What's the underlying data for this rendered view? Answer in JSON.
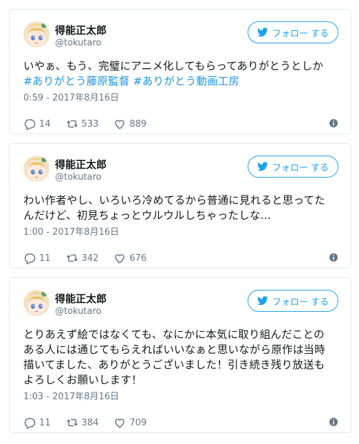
{
  "follow_label": "フォロー する",
  "tweets": [
    {
      "name": "得能正太郎",
      "handle": "@tokutaro",
      "lines": [
        [
          {
            "t": "いやぁ、もう、完璧にアニメ化してもらってありがとうとしか",
            "tag": false
          }
        ],
        [
          {
            "t": "#ありがとう藤原監督",
            "tag": true
          },
          {
            "t": " ",
            "tag": false
          },
          {
            "t": "#ありがとう動画工房",
            "tag": true
          }
        ]
      ],
      "time": "0:59 - 2017年8月16日",
      "replies": "14",
      "retweets": "533",
      "likes": "889"
    },
    {
      "name": "得能正太郎",
      "handle": "@tokutaro",
      "lines": [
        [
          {
            "t": "わい作者やし、いろいろ冷めてるから普通に見れると思ってた",
            "tag": false
          }
        ],
        [
          {
            "t": "んだけど、初見ちょっとウルウルしちゃったしな...",
            "tag": false
          }
        ]
      ],
      "time": "1:00 - 2017年8月16日",
      "replies": "11",
      "retweets": "342",
      "likes": "676"
    },
    {
      "name": "得能正太郎",
      "handle": "@tokutaro",
      "lines": [
        [
          {
            "t": "とりあえず絵ではなくても、なにかに本気に取り組んだことの",
            "tag": false
          }
        ],
        [
          {
            "t": "ある人には通じてもらえればいいなぁと思いながら原作は当時",
            "tag": false
          }
        ],
        [
          {
            "t": "描いてました、ありがとうございました！引き続き残り放送も",
            "tag": false
          }
        ],
        [
          {
            "t": "よろしくお願いします！",
            "tag": false
          }
        ]
      ],
      "time": "1:03 - 2017年8月16日",
      "replies": "11",
      "retweets": "384",
      "likes": "709"
    }
  ],
  "colors": {
    "accent": "#1da1f2",
    "hashtag": "#1b95e0",
    "muted": "#657786",
    "border": "#e1e8ed"
  }
}
